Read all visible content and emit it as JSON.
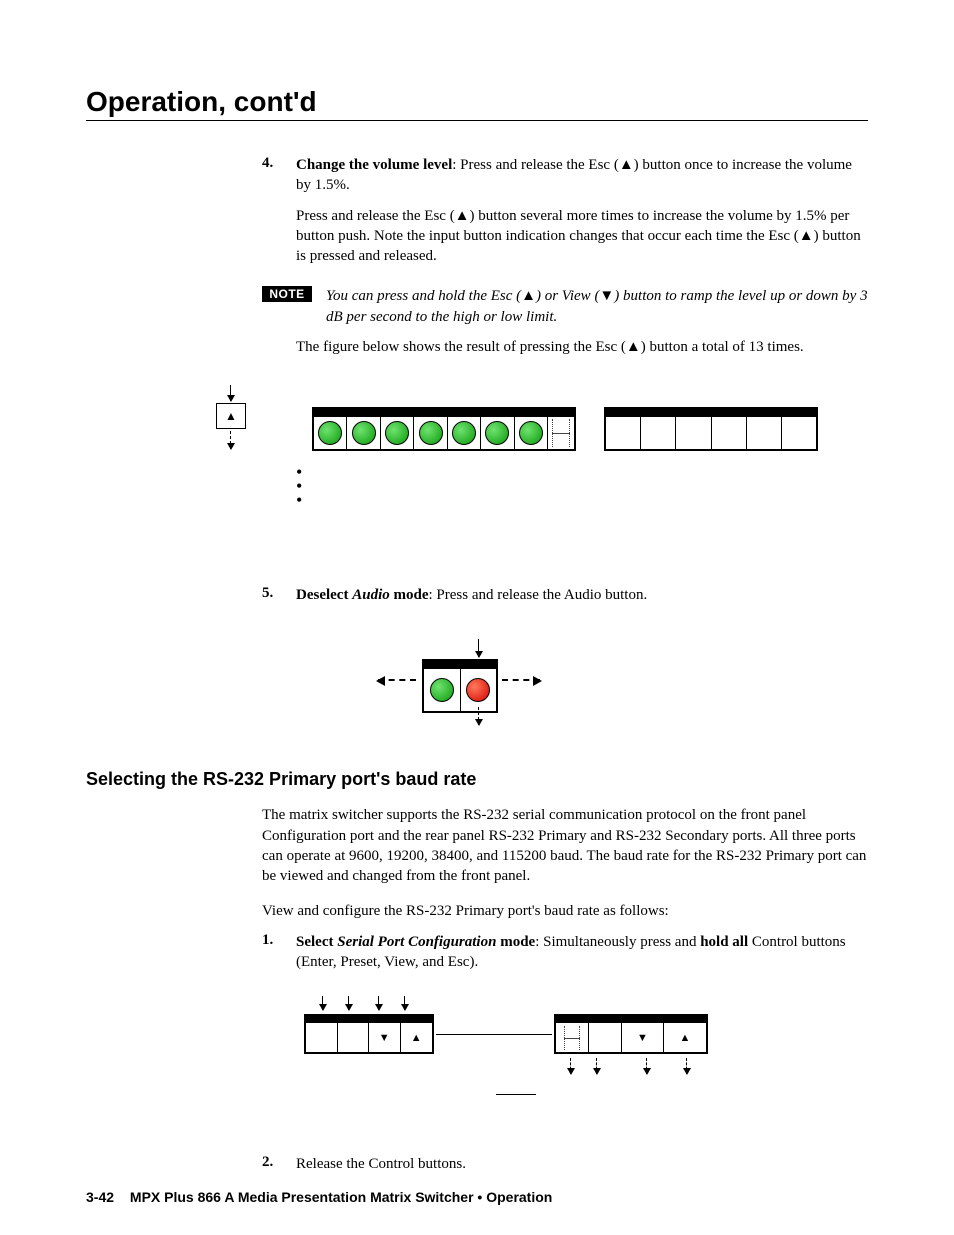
{
  "page_title": "Operation, cont'd",
  "step4": {
    "num": "4.",
    "lead": "Change the volume level",
    "text1": ": Press and release the Esc (▲) button once to increase the volume by 1.5%.",
    "para2": "Press and release the Esc (▲) button several more times to increase the volume by 1.5% per button push.  Note the input button indication changes that occur each time the Esc (▲) button is pressed and released."
  },
  "note": {
    "badge": "NOTE",
    "text": "You can press and hold the Esc (▲) or View (▼) button to ramp the level up or down by 3 dB per second to the high or low limit."
  },
  "fig_intro": "The figure below shows the result of pressing the Esc (▲) button a total of 13 times.",
  "step5": {
    "num": "5.",
    "lead_a": "Deselect ",
    "lead_b": "Audio",
    "lead_c": " mode",
    "text": ": Press and release the Audio button."
  },
  "subheading": "Selecting the RS-232 Primary port's baud rate",
  "rs232_p1": "The matrix switcher supports the RS-232 serial communication protocol on the front panel Configuration port and the rear panel RS-232 Primary and RS-232 Secondary ports.  All three ports can operate at 9600, 19200, 38400, and 115200 baud.  The baud rate for the RS-232 Primary port can be viewed and changed from the front panel.",
  "rs232_p2": "View and configure the RS-232 Primary port's baud rate as follows:",
  "step1": {
    "num": "1.",
    "lead_a": "Select ",
    "lead_b": "Serial Port Configuration",
    "lead_c": " mode",
    "text1": ": Simultaneously press and ",
    "hold": "hold all",
    "text2": " Control buttons (Enter, Preset, View, and Esc)."
  },
  "step2": {
    "num": "2.",
    "text": "Release the Control buttons."
  },
  "footer": {
    "page": "3-42",
    "product": "MPX Plus 866 A Media Presentation Matrix Switcher • Operation"
  }
}
